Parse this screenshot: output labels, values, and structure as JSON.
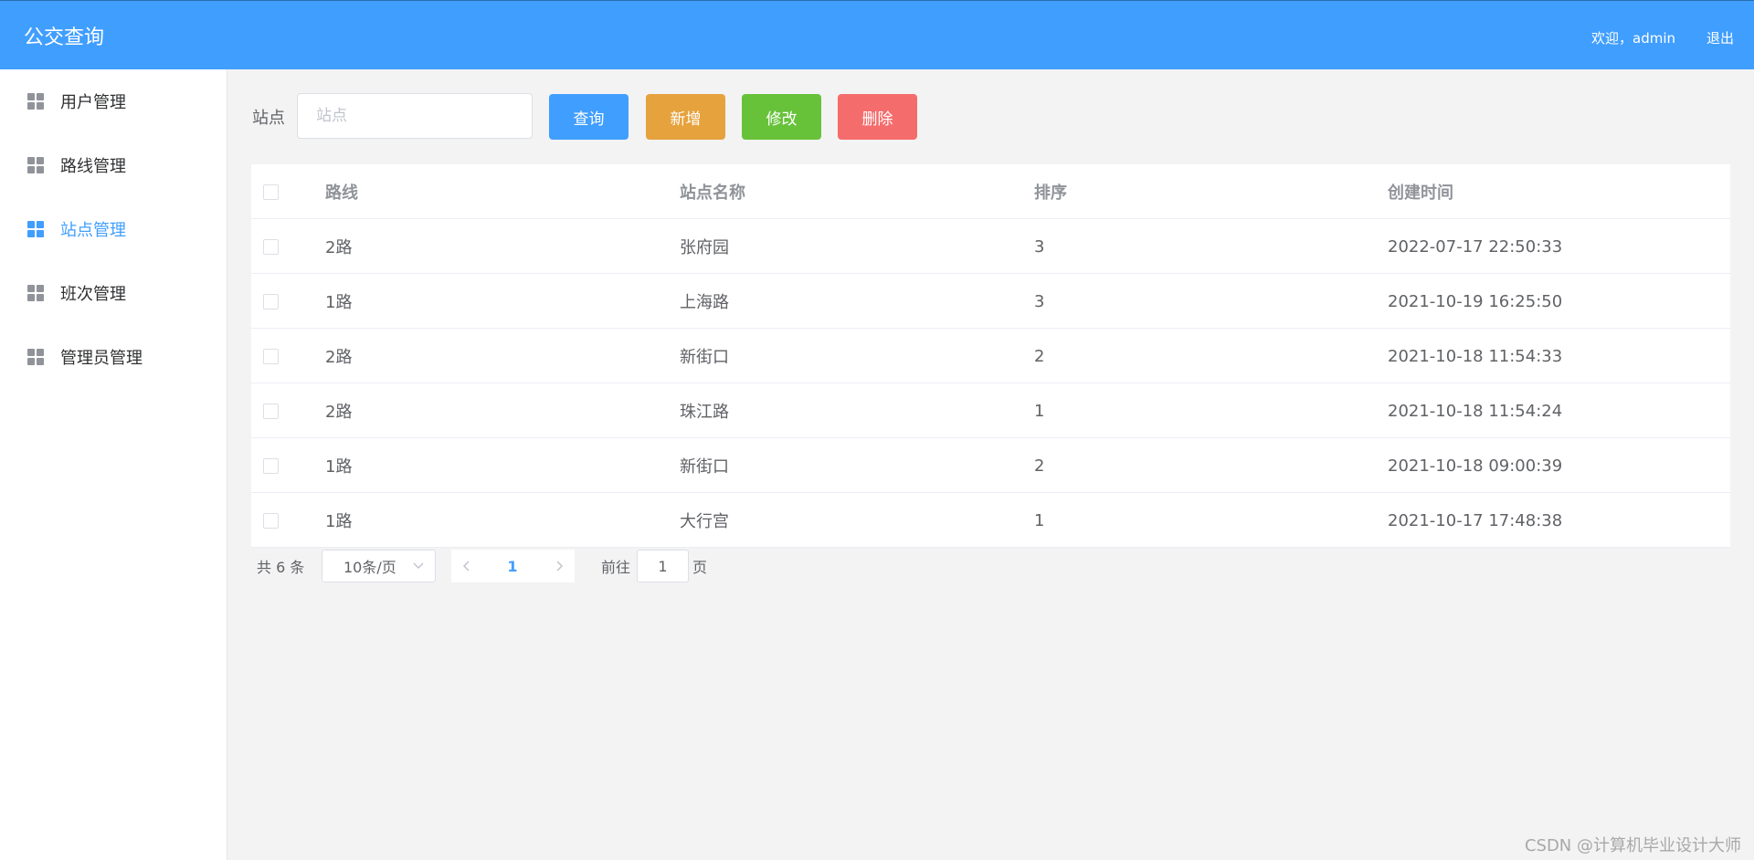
{
  "header": {
    "title": "公交查询",
    "welcome": "欢迎，admin",
    "logout": "退出",
    "background": "#409eff"
  },
  "sidebar": {
    "items": [
      {
        "label": "用户管理",
        "icon": "grid-icon",
        "active": false
      },
      {
        "label": "路线管理",
        "icon": "grid-icon",
        "active": false
      },
      {
        "label": "站点管理",
        "icon": "grid-icon",
        "active": true
      },
      {
        "label": "班次管理",
        "icon": "grid-icon",
        "active": false
      },
      {
        "label": "管理员管理",
        "icon": "grid-icon",
        "active": false
      }
    ]
  },
  "toolbar": {
    "filter_label": "站点",
    "search_placeholder": "站点",
    "search_value": "",
    "query_label": "查询",
    "add_label": "新增",
    "edit_label": "修改",
    "delete_label": "删除"
  },
  "table": {
    "columns": [
      "路线",
      "站点名称",
      "排序",
      "创建时间"
    ],
    "rows": [
      {
        "route": "2路",
        "stop": "张府园",
        "sort": "3",
        "created": "2022-07-17 22:50:33"
      },
      {
        "route": "1路",
        "stop": "上海路",
        "sort": "3",
        "created": "2021-10-19 16:25:50"
      },
      {
        "route": "2路",
        "stop": "新街口",
        "sort": "2",
        "created": "2021-10-18 11:54:33"
      },
      {
        "route": "2路",
        "stop": "珠江路",
        "sort": "1",
        "created": "2021-10-18 11:54:24"
      },
      {
        "route": "1路",
        "stop": "新街口",
        "sort": "2",
        "created": "2021-10-18 09:00:39"
      },
      {
        "route": "1路",
        "stop": "大行宫",
        "sort": "1",
        "created": "2021-10-17 17:48:38"
      }
    ]
  },
  "pagination": {
    "total_text": "共 6 条",
    "page_size": "10条/页",
    "current_page": "1",
    "goto_label": "前往",
    "goto_value": "1",
    "goto_unit": "页"
  },
  "watermark": "CSDN @计算机毕业设计大师"
}
